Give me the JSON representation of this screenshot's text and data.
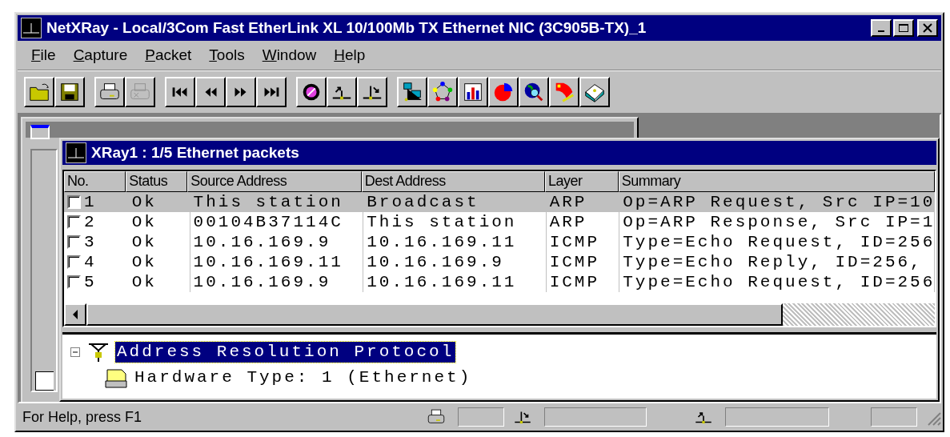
{
  "window": {
    "title": "NetXRay - Local/3Com Fast EtherLink XL 10/100Mb TX Ethernet NIC (3C905B-TX)_1"
  },
  "menu": [
    {
      "label": "File"
    },
    {
      "label": "Capture"
    },
    {
      "label": "Packet"
    },
    {
      "label": "Tools"
    },
    {
      "label": "Window"
    },
    {
      "label": "Help"
    }
  ],
  "toolbar": [
    [
      {
        "kind": "open"
      },
      {
        "kind": "save"
      }
    ],
    [
      {
        "kind": "print"
      },
      {
        "kind": "print-disabled"
      }
    ],
    [
      {
        "kind": "first"
      },
      {
        "kind": "prev"
      },
      {
        "kind": "next"
      },
      {
        "kind": "last"
      }
    ],
    [
      {
        "kind": "disc"
      },
      {
        "kind": "send"
      },
      {
        "kind": "receive"
      }
    ],
    [
      {
        "kind": "hosts"
      },
      {
        "kind": "ring"
      },
      {
        "kind": "bars"
      },
      {
        "kind": "pie"
      },
      {
        "kind": "globe"
      },
      {
        "kind": "alarm"
      },
      {
        "kind": "box"
      }
    ]
  ],
  "packet_window": {
    "title": "XRay1 : 1/5 Ethernet packets",
    "table": {
      "columns": [
        "No.",
        "Status",
        "Source Address",
        "Dest Address",
        "Layer",
        "Summary"
      ],
      "rows": [
        {
          "selected": true,
          "checked": false,
          "cells": [
            "1",
            "Ok",
            "This station",
            "Broadcast",
            "ARP",
            "Op=ARP Request, Src IP=10"
          ]
        },
        {
          "selected": false,
          "checked": false,
          "cells": [
            "2",
            "Ok",
            "00104B37114C",
            "This station",
            "ARP",
            "Op=ARP Response, Src IP=1"
          ]
        },
        {
          "selected": false,
          "checked": false,
          "cells": [
            "3",
            "Ok",
            "10.16.169.9",
            "10.16.169.11",
            "ICMP",
            "Type=Echo Request, ID=256"
          ]
        },
        {
          "selected": false,
          "checked": false,
          "cells": [
            "4",
            "Ok",
            "10.16.169.11",
            "10.16.169.9",
            "ICMP",
            "Type=Echo Reply, ID=256,"
          ]
        },
        {
          "selected": false,
          "checked": false,
          "cells": [
            "5",
            "Ok",
            "10.16.169.9",
            "10.16.169.11",
            "ICMP",
            "Type=Echo Request, ID=256"
          ]
        }
      ]
    },
    "tree": [
      {
        "label": "Address Resolution Protocol",
        "expanded": true,
        "selected": true,
        "children": [
          {
            "label": "Hardware Type: 1 (Ethernet)"
          }
        ]
      }
    ]
  },
  "status_bar": {
    "text": "For Help, press F1"
  }
}
